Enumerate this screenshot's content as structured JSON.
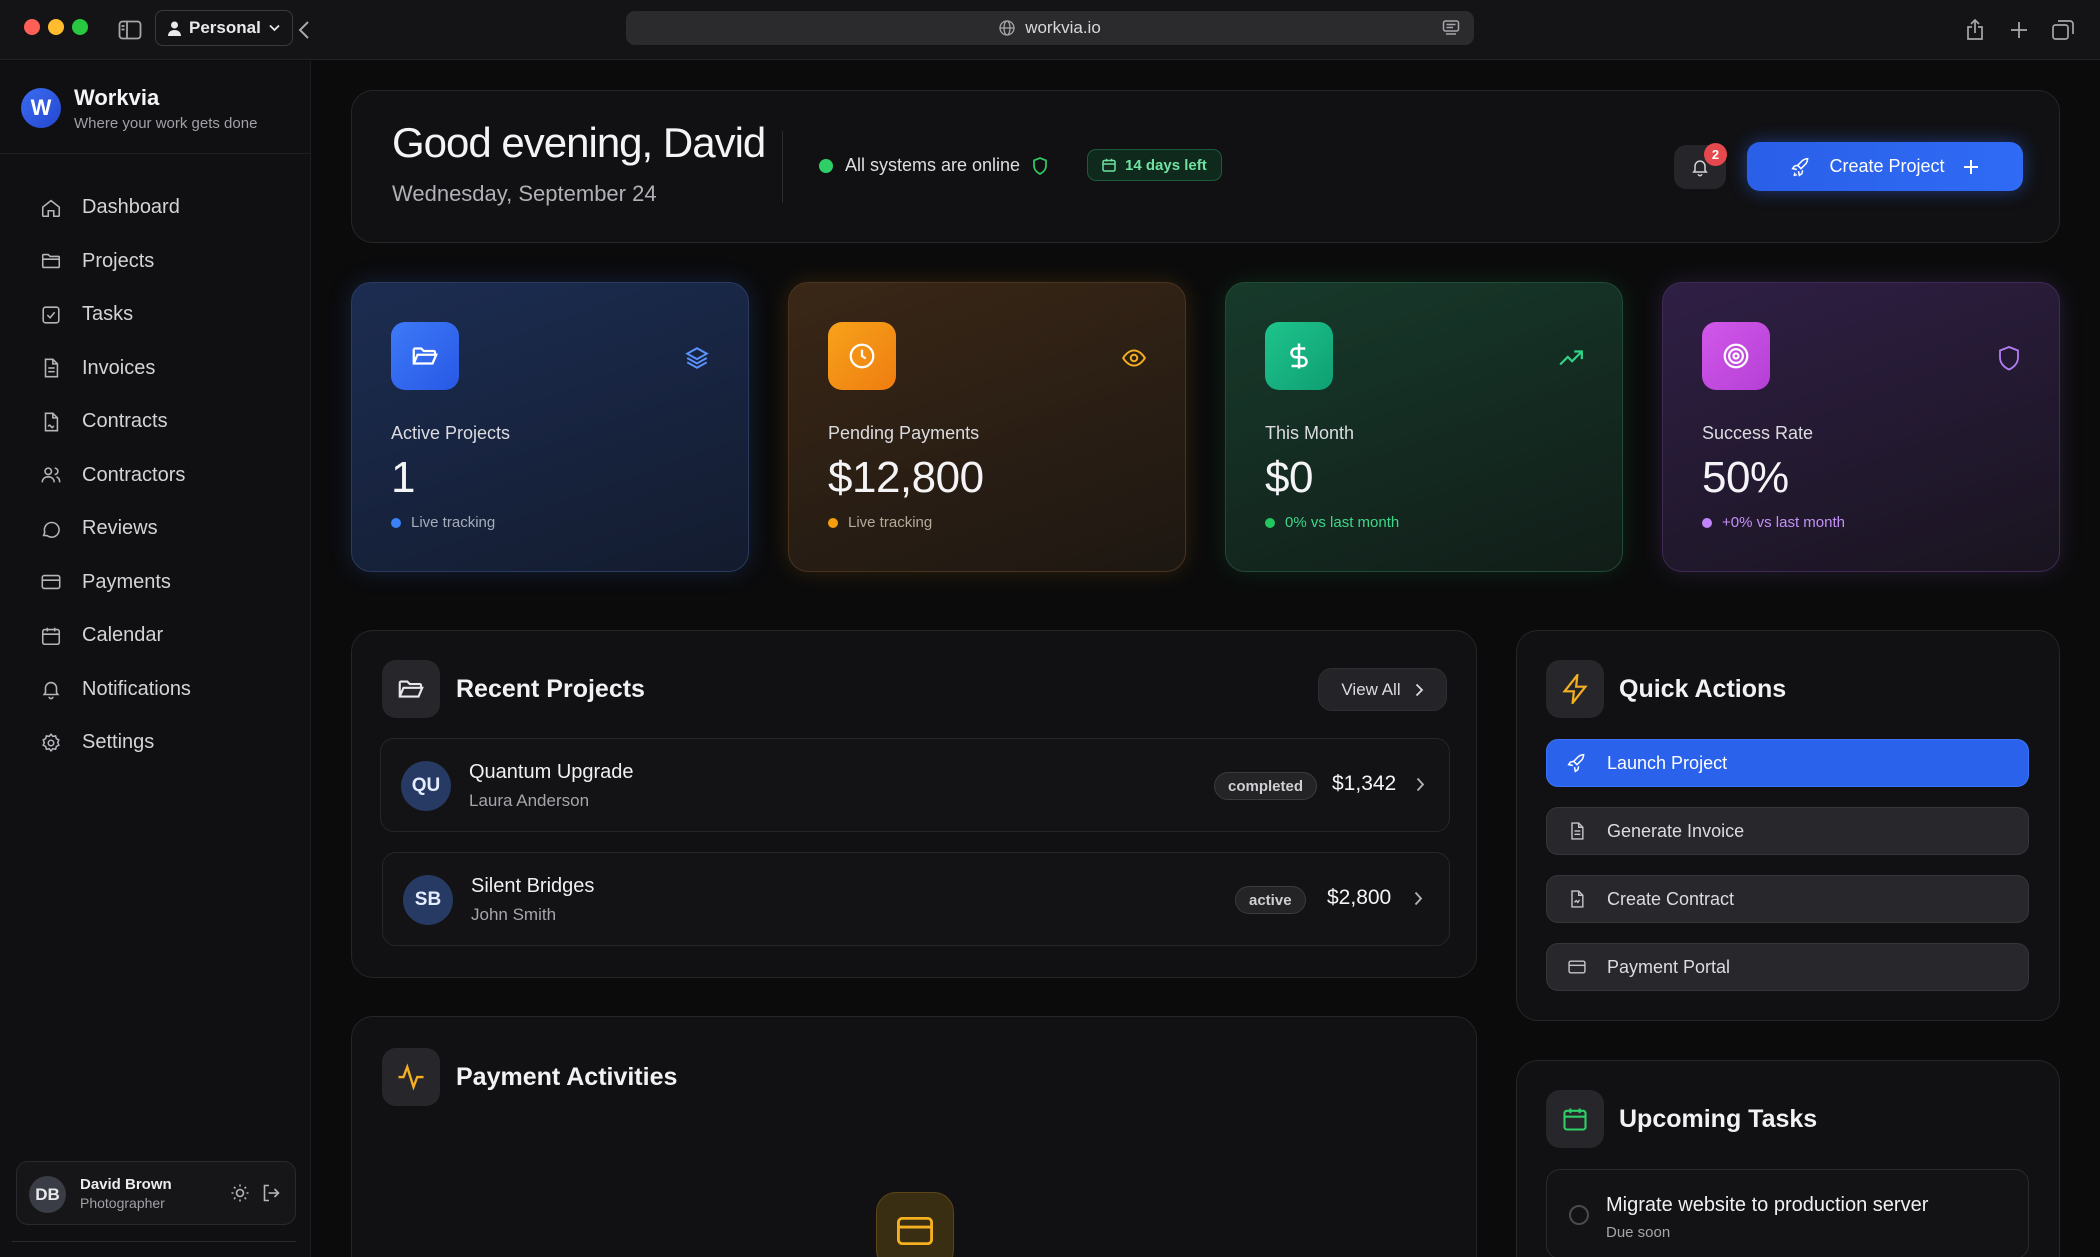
{
  "browser": {
    "profile": "Personal",
    "url": "workvia.io"
  },
  "brand": {
    "logo_letter": "W",
    "name": "Workvia",
    "tagline": "Where your work gets done"
  },
  "nav": [
    {
      "label": "Dashboard",
      "icon": "home-icon"
    },
    {
      "label": "Projects",
      "icon": "folder-icon"
    },
    {
      "label": "Tasks",
      "icon": "check-square-icon"
    },
    {
      "label": "Invoices",
      "icon": "file-text-icon"
    },
    {
      "label": "Contracts",
      "icon": "file-signature-icon"
    },
    {
      "label": "Contractors",
      "icon": "users-icon"
    },
    {
      "label": "Reviews",
      "icon": "message-circle-icon"
    },
    {
      "label": "Payments",
      "icon": "credit-card-icon"
    },
    {
      "label": "Calendar",
      "icon": "calendar-icon"
    },
    {
      "label": "Notifications",
      "icon": "bell-icon"
    },
    {
      "label": "Settings",
      "icon": "gear-icon"
    }
  ],
  "user": {
    "initials": "DB",
    "name": "David Brown",
    "role": "Photographer"
  },
  "header": {
    "greeting": "Good evening, David",
    "date": "Wednesday, September 24",
    "status": "All systems are online",
    "trial": "14 days left",
    "notification_count": "2",
    "create_label": "Create Project"
  },
  "stats": [
    {
      "label": "Active Projects",
      "value": "1",
      "note": "Live tracking",
      "color": "#3b82f6"
    },
    {
      "label": "Pending Payments",
      "value": "$12,800",
      "note": "Live tracking",
      "color": "#f59e0b"
    },
    {
      "label": "This Month",
      "value": "$0",
      "note": "0% vs last month",
      "color": "#22c55e"
    },
    {
      "label": "Success Rate",
      "value": "50%",
      "note": "+0% vs last month",
      "color": "#c084fc"
    }
  ],
  "recent": {
    "title": "Recent Projects",
    "view_all": "View All",
    "projects": [
      {
        "initials": "QU",
        "name": "Quantum Upgrade",
        "client": "Laura Anderson",
        "status": "completed",
        "amount": "$1,342"
      },
      {
        "initials": "SB",
        "name": "Silent Bridges",
        "client": "John Smith",
        "status": "active",
        "amount": "$2,800"
      }
    ]
  },
  "quick": {
    "title": "Quick Actions",
    "actions": [
      {
        "label": "Launch Project"
      },
      {
        "label": "Generate Invoice"
      },
      {
        "label": "Create Contract"
      },
      {
        "label": "Payment Portal"
      }
    ]
  },
  "activities": {
    "title": "Payment Activities"
  },
  "tasks": {
    "title": "Upcoming Tasks",
    "items": [
      {
        "title": "Migrate website to production server",
        "due": "Due soon"
      }
    ]
  },
  "colors": {
    "accent": "#2f6bf5",
    "online": "#2fcf68",
    "badge": "#e5484d"
  }
}
